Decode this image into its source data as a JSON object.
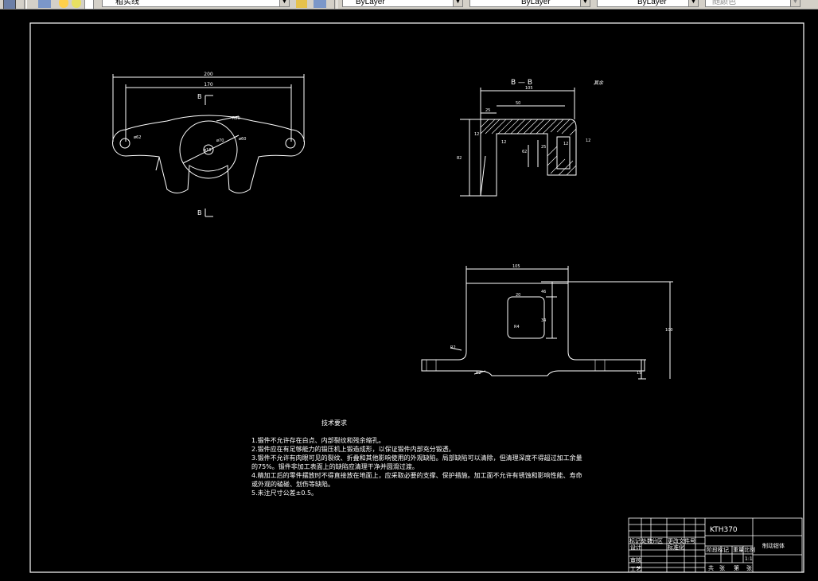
{
  "toolbar": {
    "layer_name": "粗实线",
    "color_value": "ByLayer",
    "linetype_value": "ByLayer",
    "lineweight_value": "ByLayer",
    "plotstyle_value": "随颜色"
  },
  "views": {
    "section_label": "B — B",
    "cut_top": "B",
    "cut_bottom": "B",
    "roughness_note": "其余",
    "dims_top": [
      "200",
      "170",
      "ø62",
      "ø70",
      "ø18",
      "ø60",
      "R20"
    ],
    "dims_section": [
      "105",
      "50",
      "25",
      "12",
      "12",
      "62",
      "25",
      "12",
      "12",
      "82"
    ],
    "dims_bottom": [
      "105",
      "20",
      "46",
      "34",
      "R4",
      "R2",
      "R2",
      "100",
      "15"
    ]
  },
  "tech": {
    "heading": "技术要求",
    "lines": [
      "1.锻件不允许存在白点、内部裂纹和残余缩孔。",
      "2.锻件应在有足够能力的锻压机上锻造成形，以保证锻件内部充分锻透。",
      "3.锻件不允许有肉眼可见的裂纹、折叠和其他影响使用的外观缺陷。局部缺陷可以清除，但清理深度不得超过加工余量",
      "的75%。锻件非加工表面上的缺陷应清理干净并圆滑过渡。",
      "4.精加工后的零件摆放时不得直接放在地面上，应采取必要的支撑、保护措施。加工面不允许有锈蚀和影响性能、寿命",
      "或外观的磕碰、划伤等缺陷。",
      "5.未注尺寸公差±0.5。"
    ]
  },
  "titleblock": {
    "model": "KTH370",
    "part_name": "制动钳体",
    "scale": "1:1",
    "row_labels": [
      "标记",
      "处数",
      "分区",
      "更改文件号",
      "设计",
      "标准化",
      "审核",
      "工艺"
    ],
    "stage_labels": [
      "阶段标记",
      "重量",
      "比例"
    ],
    "sheet_labels": [
      "共",
      "张",
      "第",
      "张"
    ]
  }
}
